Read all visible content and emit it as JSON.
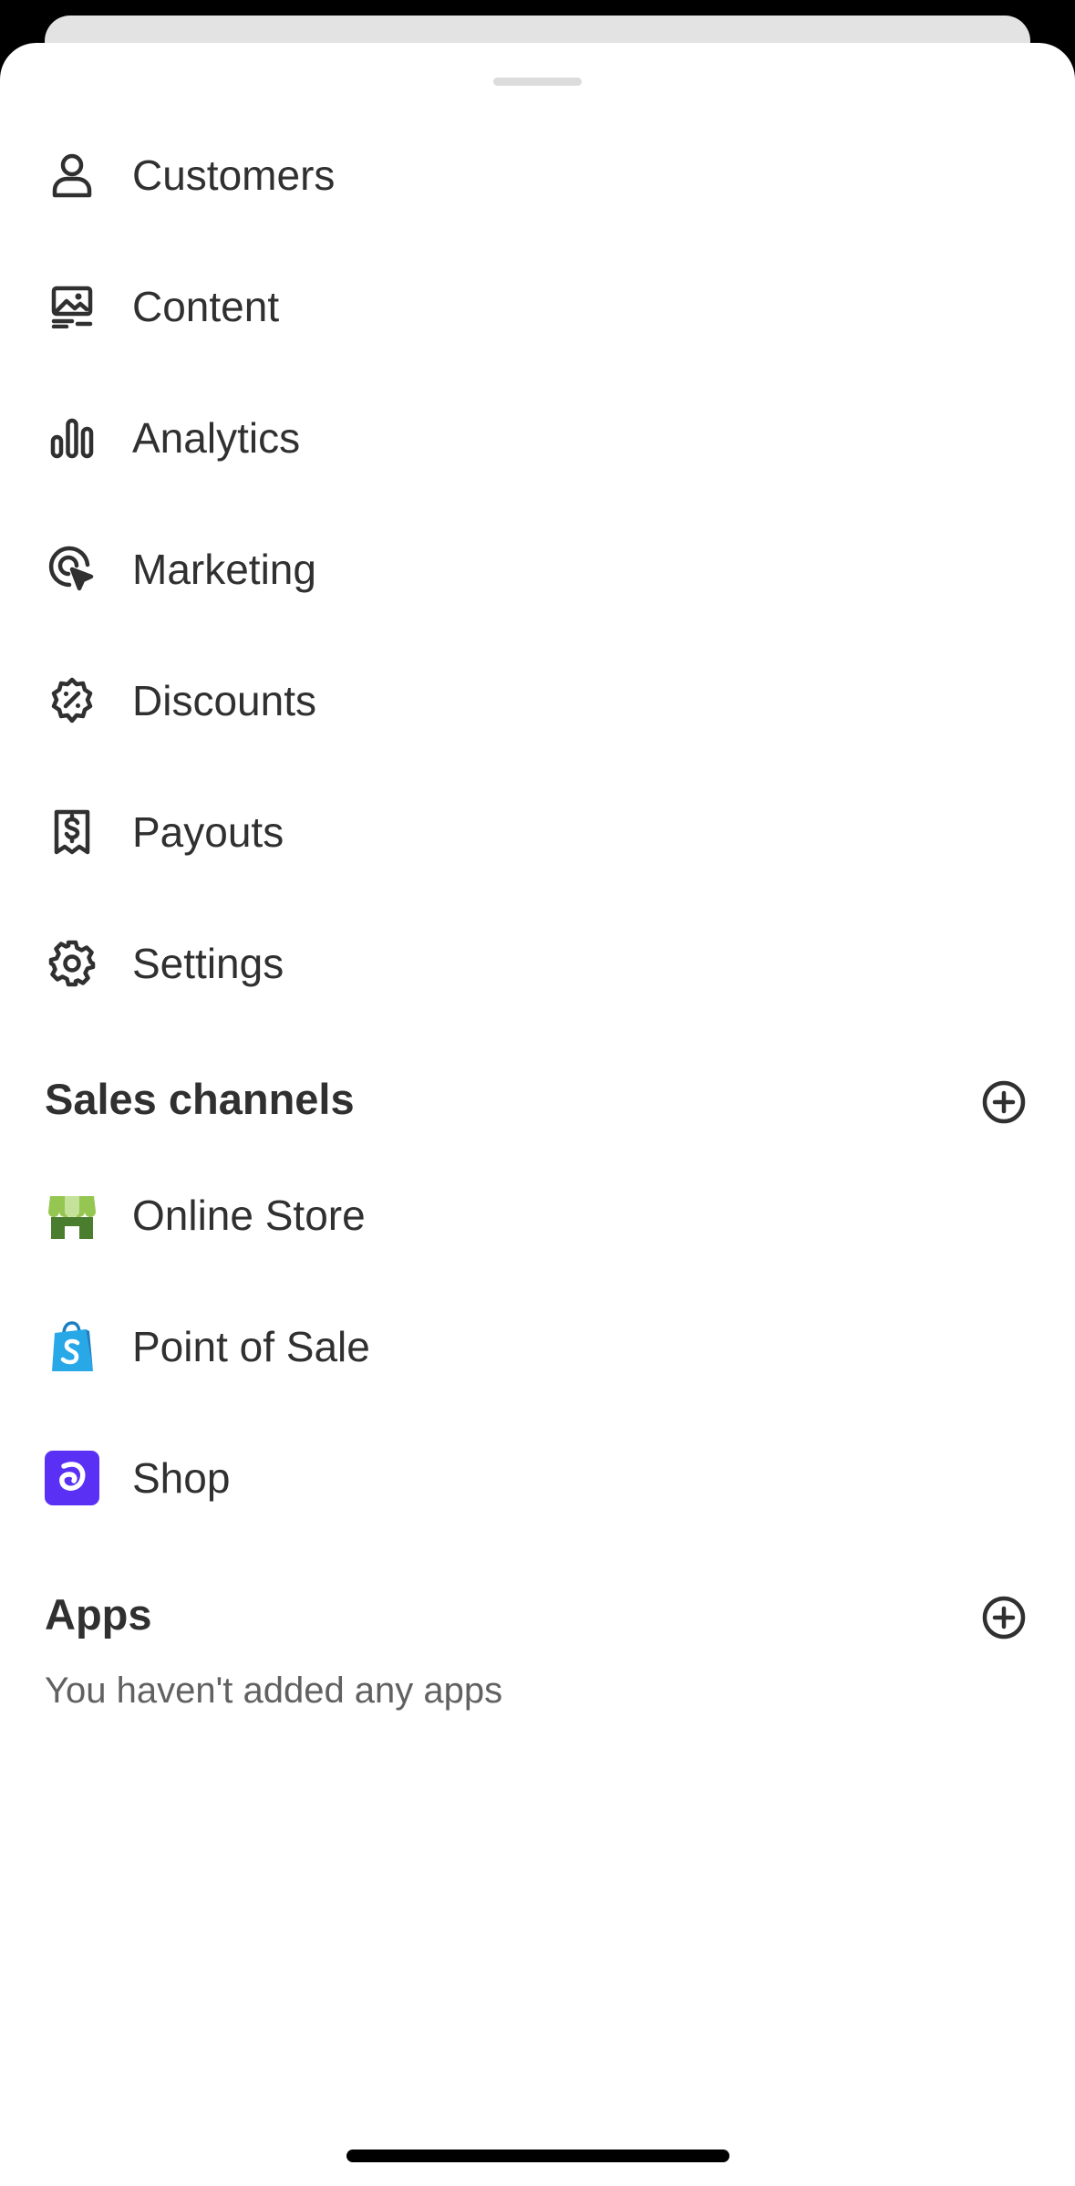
{
  "menu": {
    "items": [
      {
        "label": "Customers",
        "icon": "person-icon"
      },
      {
        "label": "Content",
        "icon": "image-icon"
      },
      {
        "label": "Analytics",
        "icon": "bar-chart-icon"
      },
      {
        "label": "Marketing",
        "icon": "target-cursor-icon"
      },
      {
        "label": "Discounts",
        "icon": "discount-badge-icon"
      },
      {
        "label": "Payouts",
        "icon": "receipt-dollar-icon"
      },
      {
        "label": "Settings",
        "icon": "gear-icon"
      }
    ]
  },
  "sales_channels": {
    "title": "Sales channels",
    "add_icon": "plus-circle-icon",
    "items": [
      {
        "label": "Online Store",
        "icon": "online-store-icon"
      },
      {
        "label": "Point of Sale",
        "icon": "shopify-bag-icon"
      },
      {
        "label": "Shop",
        "icon": "shop-app-icon"
      }
    ]
  },
  "apps": {
    "title": "Apps",
    "add_icon": "plus-circle-icon",
    "empty_text": "You haven't added any apps"
  },
  "colors": {
    "text": "#303030",
    "secondary_text": "#616161",
    "shop_purple": "#5a31f4",
    "store_green": "#4b7d2f",
    "pos_blue": "#29a8e8"
  }
}
